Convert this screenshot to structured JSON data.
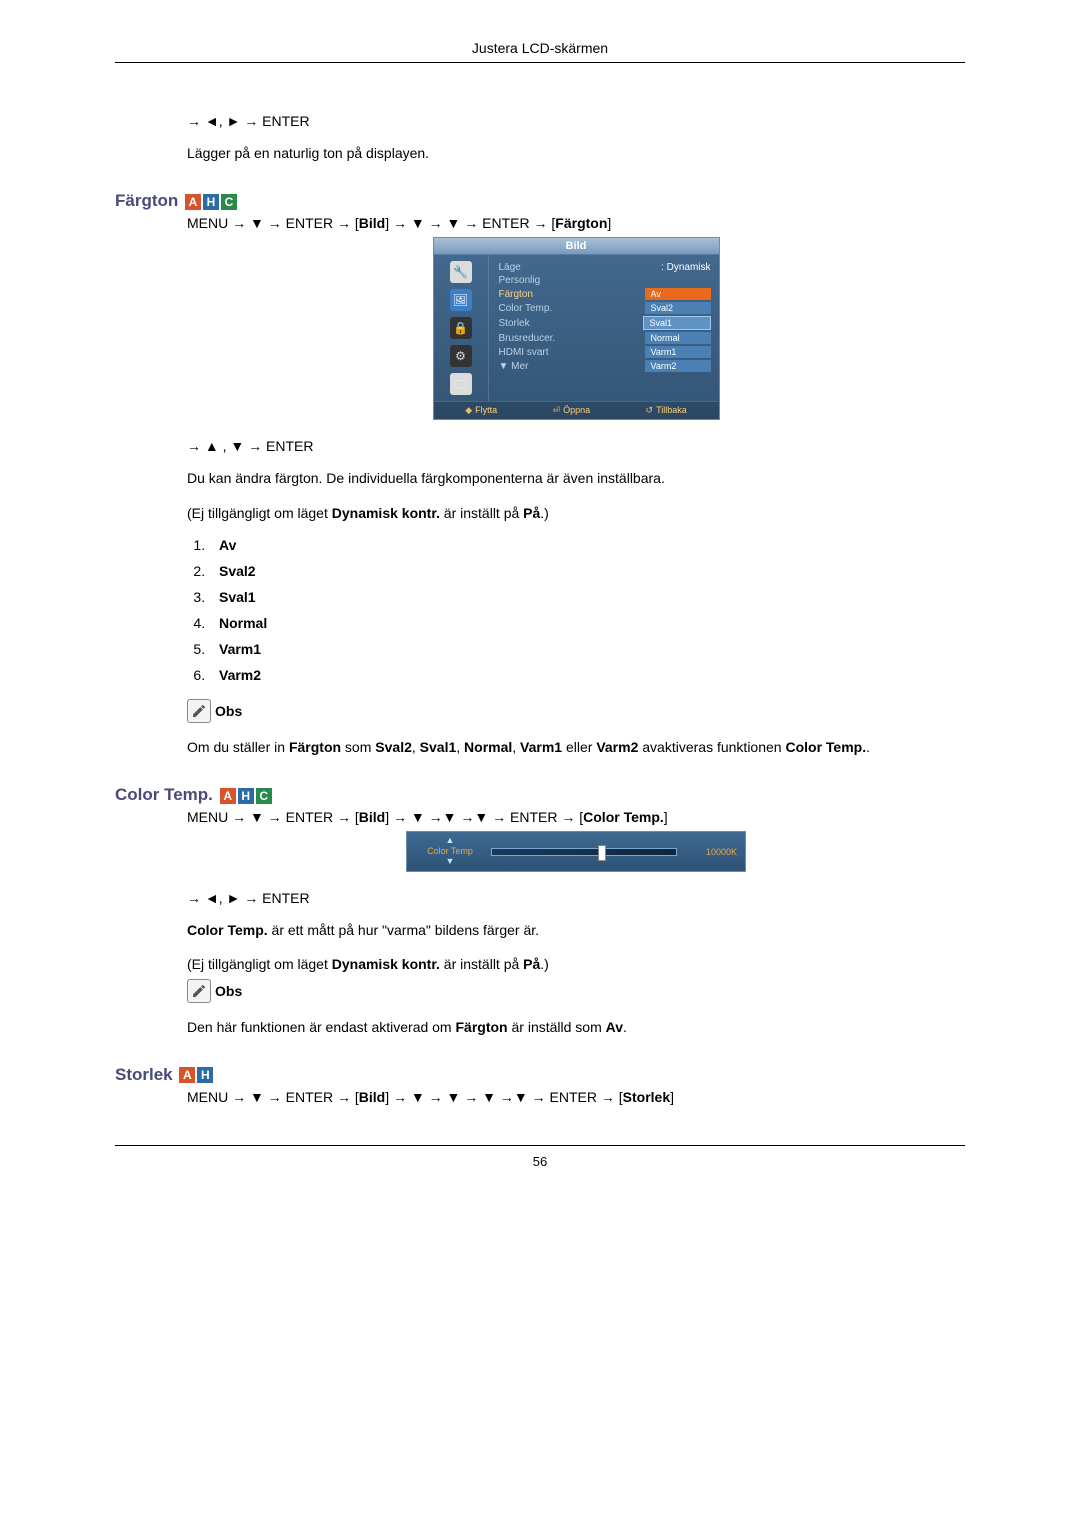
{
  "header": {
    "title": "Justera LCD-skärmen"
  },
  "intro": {
    "nav": "→ ◄, ► → ENTER",
    "desc": "Lägger på en naturlig ton på displayen."
  },
  "fargton": {
    "heading": "Färgton",
    "badges": [
      "A",
      "H",
      "C"
    ],
    "menu_path": {
      "pre": "MENU → ▼ → ENTER → [",
      "bild": "Bild",
      "mid": "] → ▼ → ▼ → ENTER → [",
      "farg": "Färgton",
      "post": "]"
    },
    "osd": {
      "title": "Bild",
      "side_icons": [
        "🔧",
        "🖼",
        "🔒",
        "⚙",
        "🖵"
      ],
      "rows": [
        {
          "label": "Läge",
          "value": ": Dynamisk",
          "plain": true
        },
        {
          "label": "Personlig",
          "value": ""
        },
        {
          "label": "Färgton",
          "value": "Av",
          "selected": true,
          "active": true
        },
        {
          "label": "Color Temp.",
          "value": "Sval2"
        },
        {
          "label": "Storlek",
          "value": "Sval1",
          "highlight": true
        },
        {
          "label": "Brusreducer.",
          "value": "Normal"
        },
        {
          "label": "HDMI svart",
          "value": "Varm1"
        },
        {
          "label": "▼ Mer",
          "value": "Varm2"
        }
      ],
      "foot": [
        {
          "k": "◆",
          "t": "Flytta"
        },
        {
          "k": "⏎",
          "t": "Öppna"
        },
        {
          "k": "↺",
          "t": "Tillbaka"
        }
      ]
    },
    "nav2": "→ ▲ , ▼ → ENTER",
    "p1": "Du kan ändra färgton. De individuella färgkomponenterna är även inställbara.",
    "p2_pre": "(Ej tillgängligt om läget ",
    "p2_b1": "Dynamisk kontr.",
    "p2_mid": " är inställt på ",
    "p2_b2": "På",
    "p2_post": ".)",
    "options": [
      "Av",
      "Sval2",
      "Sval1",
      "Normal",
      "Varm1",
      "Varm2"
    ],
    "note_label": "Obs",
    "note_pre": "Om du ställer in ",
    "note_b1": "Färgton",
    "note_m1": " som ",
    "note_b2": "Sval2",
    "note_c": ", ",
    "note_b3": "Sval1",
    "note_b4": "Normal",
    "note_b5": "Varm1",
    "note_or": " eller ",
    "note_b6": "Varm2",
    "note_m2": " avaktiveras funktio",
    "note_m3": "nen ",
    "note_b7": "Color Temp.",
    "note_end": "."
  },
  "colortemp": {
    "heading": "Color Temp.",
    "badges": [
      "A",
      "H",
      "C"
    ],
    "menu_path": {
      "pre": "MENU → ▼ → ENTER → [",
      "bild": "Bild",
      "mid": "] → ▼ →▼ →▼ → ENTER → [",
      "ct": "Color Temp.",
      "post": "]"
    },
    "osd": {
      "label": "Color Temp",
      "value": "10000K",
      "handle_pct": 60
    },
    "nav2": "→ ◄, ► → ENTER",
    "p1_b": "Color Temp.",
    "p1_rest": " är ett mått på hur \"varma\" bildens färger är.",
    "p2_pre": "(Ej tillgängligt om läget ",
    "p2_b1": "Dynamisk kontr.",
    "p2_mid": " är inställt på ",
    "p2_b2": "På",
    "p2_post": ".)",
    "note_label": "Obs",
    "note_pre": "Den här funktionen är endast aktiverad om ",
    "note_b": "Färgton",
    "note_mid": " är inställd som ",
    "note_b2": "Av",
    "note_end": "."
  },
  "storlek": {
    "heading": "Storlek",
    "badges": [
      "A",
      "H"
    ],
    "menu_path": {
      "pre": "MENU → ▼ → ENTER → [",
      "bild": "Bild",
      "mid": "] → ▼ → ▼ → ▼ →▼ → ENTER → [",
      "st": "Storlek",
      "post": "]"
    }
  },
  "footer": {
    "page": "56"
  }
}
